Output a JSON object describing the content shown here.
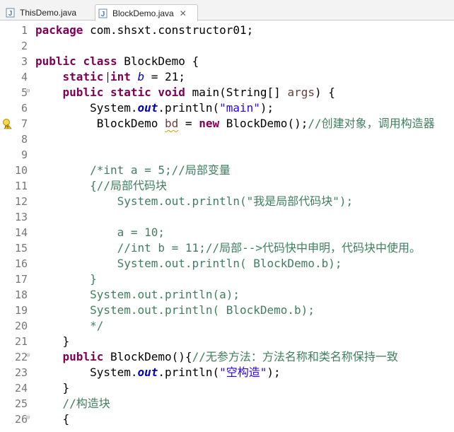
{
  "tabs": [
    {
      "label": "ThisDemo.java",
      "icon": "java-file-icon",
      "active": false
    },
    {
      "label": "BlockDemo.java",
      "icon": "java-file-icon",
      "active": true,
      "close": "✕"
    }
  ],
  "editor": {
    "lines": [
      {
        "n": "1",
        "code": "package com.shsxt.constructor01;"
      },
      {
        "n": "2",
        "code": ""
      },
      {
        "n": "3",
        "code": "public class BlockDemo {"
      },
      {
        "n": "4",
        "code": "    static int b = 21;"
      },
      {
        "n": "5",
        "code": "    public static void main(String[] args) {",
        "fold": true
      },
      {
        "n": "6",
        "code": "        System.out.println(\"main\");"
      },
      {
        "n": "7",
        "code": "         BlockDemo bd = new BlockDemo();//创建对象，调用构造器",
        "warning": true
      },
      {
        "n": "8",
        "code": ""
      },
      {
        "n": "9",
        "code": ""
      },
      {
        "n": "10",
        "code": "        /*int a = 5;//局部变量"
      },
      {
        "n": "11",
        "code": "        {//局部代码块"
      },
      {
        "n": "12",
        "code": "            System.out.println(\"我是局部代码块\");"
      },
      {
        "n": "13",
        "code": ""
      },
      {
        "n": "14",
        "code": "            a = 10;"
      },
      {
        "n": "15",
        "code": "            //int b = 11;//局部-->代码快中申明，代码块中使用。"
      },
      {
        "n": "16",
        "code": "            System.out.println( BlockDemo.b);"
      },
      {
        "n": "17",
        "code": "        }"
      },
      {
        "n": "18",
        "code": "        System.out.println(a);"
      },
      {
        "n": "19",
        "code": "        System.out.println( BlockDemo.b);"
      },
      {
        "n": "20",
        "code": "        */"
      },
      {
        "n": "21",
        "code": "    }"
      },
      {
        "n": "22",
        "code": "    public BlockDemo(){//无参方法：方法名称和类名称保持一致",
        "fold": true
      },
      {
        "n": "23",
        "code": "        System.out.println(\"空构造\");"
      },
      {
        "n": "24",
        "code": "    }"
      },
      {
        "n": "25",
        "code": "    //构造块"
      },
      {
        "n": "26",
        "code": "    {",
        "fold": true
      }
    ]
  },
  "colors": {
    "keyword": "#7f0055",
    "string": "#2a00ff",
    "comment": "#3f7f5f",
    "field": "#0000c0",
    "local_var": "#6a3e3e",
    "warning_squiggle": "#d4a200"
  }
}
